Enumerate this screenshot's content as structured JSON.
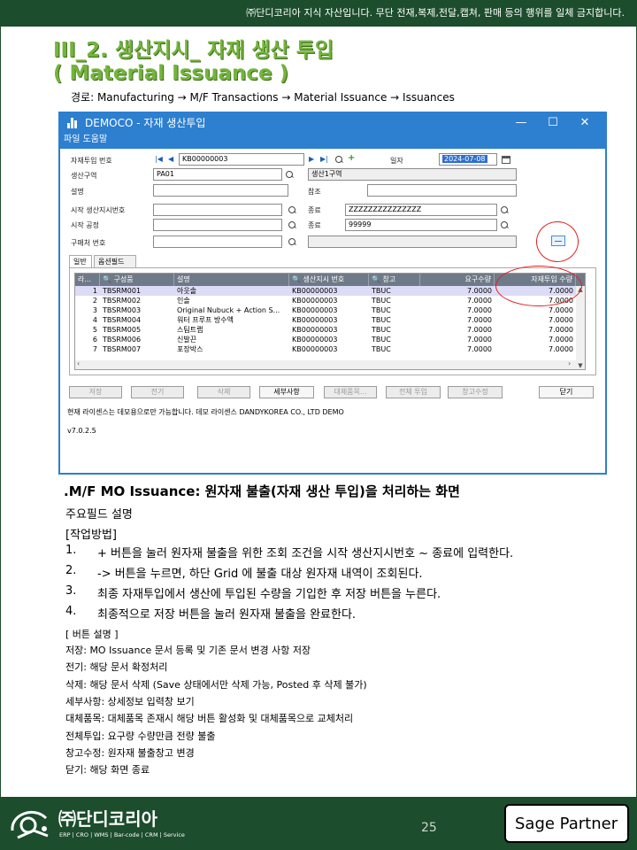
{
  "banner": "㈜단디코리아 지식 자산입니다. 무단 전재,복제,전달,캡쳐, 판매 등의 행위를 일체 금지합니다.",
  "title_line1": "III_2. 생산지시_ 자재 생산 투입",
  "title_line2": "( Material Issuance )",
  "breadcrumb": "경로: Manufacturing → M/F Transactions → Material Issuance → Issuances",
  "window": {
    "title": "DEMOCO - 자재 생산투입",
    "menu": "파일 도움말",
    "controls": {
      "minimize": "—",
      "maximize": "☐",
      "close": "✕"
    }
  },
  "form": {
    "doc_no_label": "자재투입 번호",
    "doc_no_value": "KB00000003",
    "date_label": "일자",
    "date_value": "2024-07-08",
    "prod_area_label": "생산구역",
    "prod_area_value": "PA01",
    "prod_area_name": "생산1구역",
    "desc_label": "설명",
    "ref_label": "참조",
    "start_order_label": "시작 생산지시번호",
    "end1_label": "종료",
    "end1_value": "ZZZZZZZZZZZZZZZ",
    "start_process_label": "시작 공정",
    "end2_label": "종료",
    "end2_value": "99999",
    "buyer_label": "구매처 번호"
  },
  "tabs": [
    "일반",
    "옵션필드"
  ],
  "grid": {
    "columns": [
      "라...",
      "구성품",
      "설명",
      "생산지시 번호",
      "창고",
      "요구수량",
      "자재투입 수량"
    ],
    "rows": [
      [
        "1",
        "TBSRM001",
        "아웃솔",
        "KB00000003",
        "TBUC",
        "7.0000",
        "7.0000"
      ],
      [
        "2",
        "TBSRM002",
        "인솔",
        "KB00000003",
        "TBUC",
        "7.0000",
        "7.0000"
      ],
      [
        "3",
        "TBSRM003",
        "Original Nubuck + Action S...",
        "KB00000003",
        "TBUC",
        "7.0000",
        "7.0000"
      ],
      [
        "4",
        "TBSRM004",
        "워터 프루프 방수액",
        "KB00000003",
        "TBUC",
        "7.0000",
        "7.0000"
      ],
      [
        "5",
        "TBSRM005",
        "스팀트랩",
        "KB00000003",
        "TBUC",
        "7.0000",
        "7.0000"
      ],
      [
        "6",
        "TBSRM006",
        "신발끈",
        "KB00000003",
        "TBUC",
        "7.0000",
        "7.0000"
      ],
      [
        "7",
        "TBSRM007",
        "포장박스",
        "KB00000003",
        "TBUC",
        "7.0000",
        "7.0000"
      ]
    ]
  },
  "buttons": {
    "save": "저장",
    "post": "전기",
    "delete": "삭제",
    "detail": "세부사항",
    "substitute": "대체품목...",
    "issue_all": "전체 투입",
    "warehouse": "창고수정",
    "close": "닫기"
  },
  "license": "현재 라이센스는 데모용으로만 가능합니다. 데모 라이센스 DANDYKOREA CO., LTD DEMO",
  "version": "v7.0.2.5",
  "description": {
    "heading": ".M/F MO Issuance: 원자재 불출(자재 생산 투입)을 처리하는 화면",
    "fields_title": "주요필드 설명",
    "method_title": "[작업방법]",
    "steps": [
      {
        "num": "1.",
        "text": "+ 버튼을 눌러 원자재 불출을 위한 조회 조건을 시작 생산지시번호 ~ 종료에 입력한다."
      },
      {
        "num": "2.",
        "text": "-> 버튼을 누르면, 하단 Grid 에 불출 대상 원자재 내역이 조회된다."
      },
      {
        "num": "3.",
        "text": "최종 자재투입에서 생산에 투입된 수량을 기입한 후 저장 버튼을 누른다."
      },
      {
        "num": "4.",
        "text": "최종적으로 저장 버튼을 눌러 원자재 불출을 완료한다."
      }
    ],
    "button_title": "[ 버튼 설명 ]",
    "button_desc": [
      "저장: MO Issuance 문서 등록 및 기존 문서 변경 사항 저장",
      "전기: 해당 문서 확정처리",
      "삭제: 해당 문서 삭제 (Save 상태에서만 삭제 가능, Posted 후 삭제 불가)",
      "세부사항: 상세정보 입력창 보기",
      "대체품목: 대체품목 존재시 해당 버튼 활성화 및 대체품목으로 교체처리",
      "전체투입: 요구량 수량만큼 전량 불출",
      "창고수정: 원자재 불출창고 변경",
      "닫기: 해당 화면 종료"
    ]
  },
  "footer": {
    "company": "㈜단디코리아",
    "tagline": "ERP | CRO | WMS | Bar-code | CRM | Service",
    "page": "25",
    "partner": "Sage Partner"
  },
  "colors": {
    "brand_dark_green": "#1c4d2c",
    "title_green": "#74b43c",
    "window_blue": "#2d7fd0",
    "annotation_red": "#e02020"
  }
}
